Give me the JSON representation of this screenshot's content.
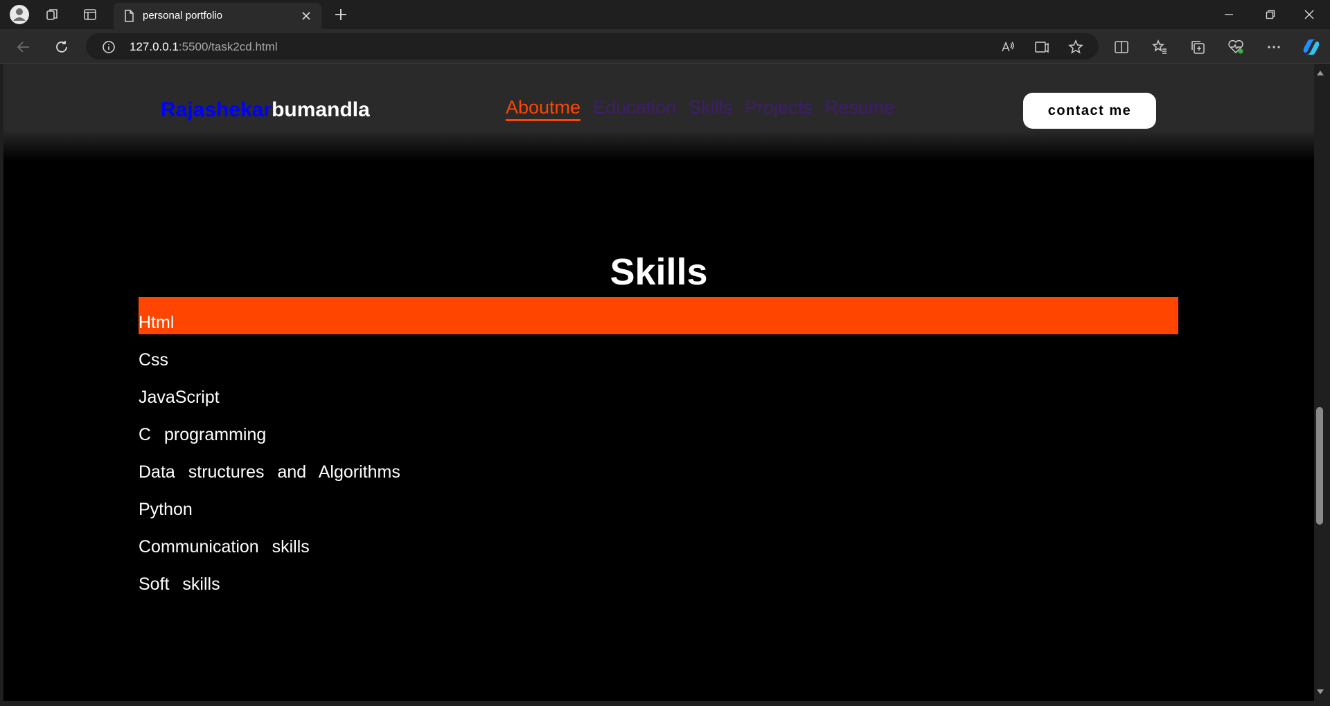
{
  "browser": {
    "tab_title": "personal portfolio",
    "url_host": "127.0.0.1",
    "url_rest": ":5500/task2cd.html"
  },
  "site": {
    "logo_first": "Rajashekar",
    "logo_last": "bumandla",
    "nav": [
      {
        "label": "Aboutme",
        "active": true
      },
      {
        "label": "Education"
      },
      {
        "label": "Skills"
      },
      {
        "label": "Projects"
      },
      {
        "label": "Resume"
      }
    ],
    "contact_label": "contact me"
  },
  "skills": {
    "title": "Skills",
    "items": [
      "Html",
      "Css",
      "JavaScript",
      "C  programming",
      "Data  structures  and  Algorithms",
      "Python",
      "Communication  skills",
      "Soft  skills"
    ]
  },
  "colors": {
    "accent": "#ff4500",
    "nav_link": "#3f1c6f",
    "logo_first": "#0000ff",
    "page_bg": "#000000"
  }
}
